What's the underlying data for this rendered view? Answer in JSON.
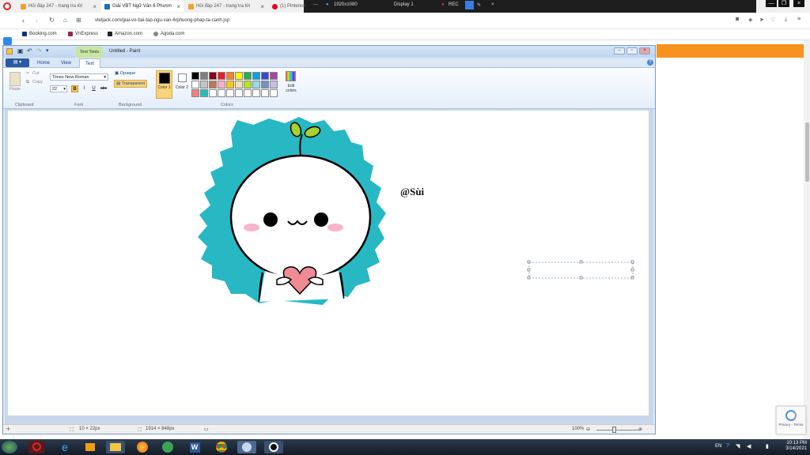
{
  "browser": {
    "tabs": [
      {
        "label": "Hỏi đáp 247 - trang tra lời",
        "color": "#f0a22e",
        "active": false
      },
      {
        "label": "Giải VBT Ngữ Văn 6 Phươn",
        "color": "#1d6fb8",
        "active": true
      },
      {
        "label": "Hỏi đáp 247 - trang tra lời",
        "color": "#f0a22e",
        "active": false
      },
      {
        "label": "(1) Pinterest",
        "color": "#e60023",
        "active": false
      }
    ],
    "recorder": {
      "resolution": "1920x1080",
      "display": "Display 1",
      "rec": "REC"
    },
    "url": "vietjack.com/giai-vo-bai-tap-ngu-van-6/phuong-phap-ta-canh.jsp",
    "bookmarks": [
      {
        "label": "Booking.com",
        "color": "#003580"
      },
      {
        "label": "VnExpress",
        "color": "#9f224e"
      },
      {
        "label": "Amazon.com",
        "color": "#222222"
      },
      {
        "label": "Agoda.com",
        "color": "#888888"
      }
    ]
  },
  "paint": {
    "title": "Untitled - Paint",
    "context_tab": "Text Tools",
    "file_button": "▤ ▾",
    "tabs": [
      "Home",
      "View",
      "Text"
    ],
    "clipboard": {
      "paste": "Paste",
      "cut": "Cut",
      "copy": "Copy",
      "group": "Clipboard"
    },
    "font": {
      "family": "Times New Roman",
      "size": "22",
      "group": "Font"
    },
    "background": {
      "opaque": "Opaque",
      "transparent": "Transparent",
      "group": "Background"
    },
    "colors": {
      "color1": "Color 1",
      "color2": "Color 2",
      "edit": "Edit colors",
      "group": "Colors",
      "palette": [
        "#000000",
        "#7f7f7f",
        "#880015",
        "#ed1c24",
        "#ff7f27",
        "#fff200",
        "#22b14c",
        "#00a2e8",
        "#3f48cc",
        "#a349a4",
        "#ffffff",
        "#c3c3c3",
        "#b97a57",
        "#ffaec9",
        "#ffc90e",
        "#efe4b0",
        "#b5e61d",
        "#99d9ea",
        "#7092be",
        "#c8bfe7",
        "#f08080",
        "#20c0c0",
        "#ffffff",
        "#ffffff",
        "#ffffff",
        "#ffffff",
        "#ffffff",
        "#ffffff",
        "#ffffff",
        "#ffffff"
      ]
    },
    "canvas_text": "@Sùi",
    "status": {
      "cursor": "10 × 22px",
      "size": "1914 × 848px",
      "zoom": "100%"
    }
  },
  "taskbar": {
    "time": "10:13 PM",
    "date": "3/14/2021",
    "lang": "EN"
  },
  "captcha": {
    "text": "Privacy - Terms"
  }
}
